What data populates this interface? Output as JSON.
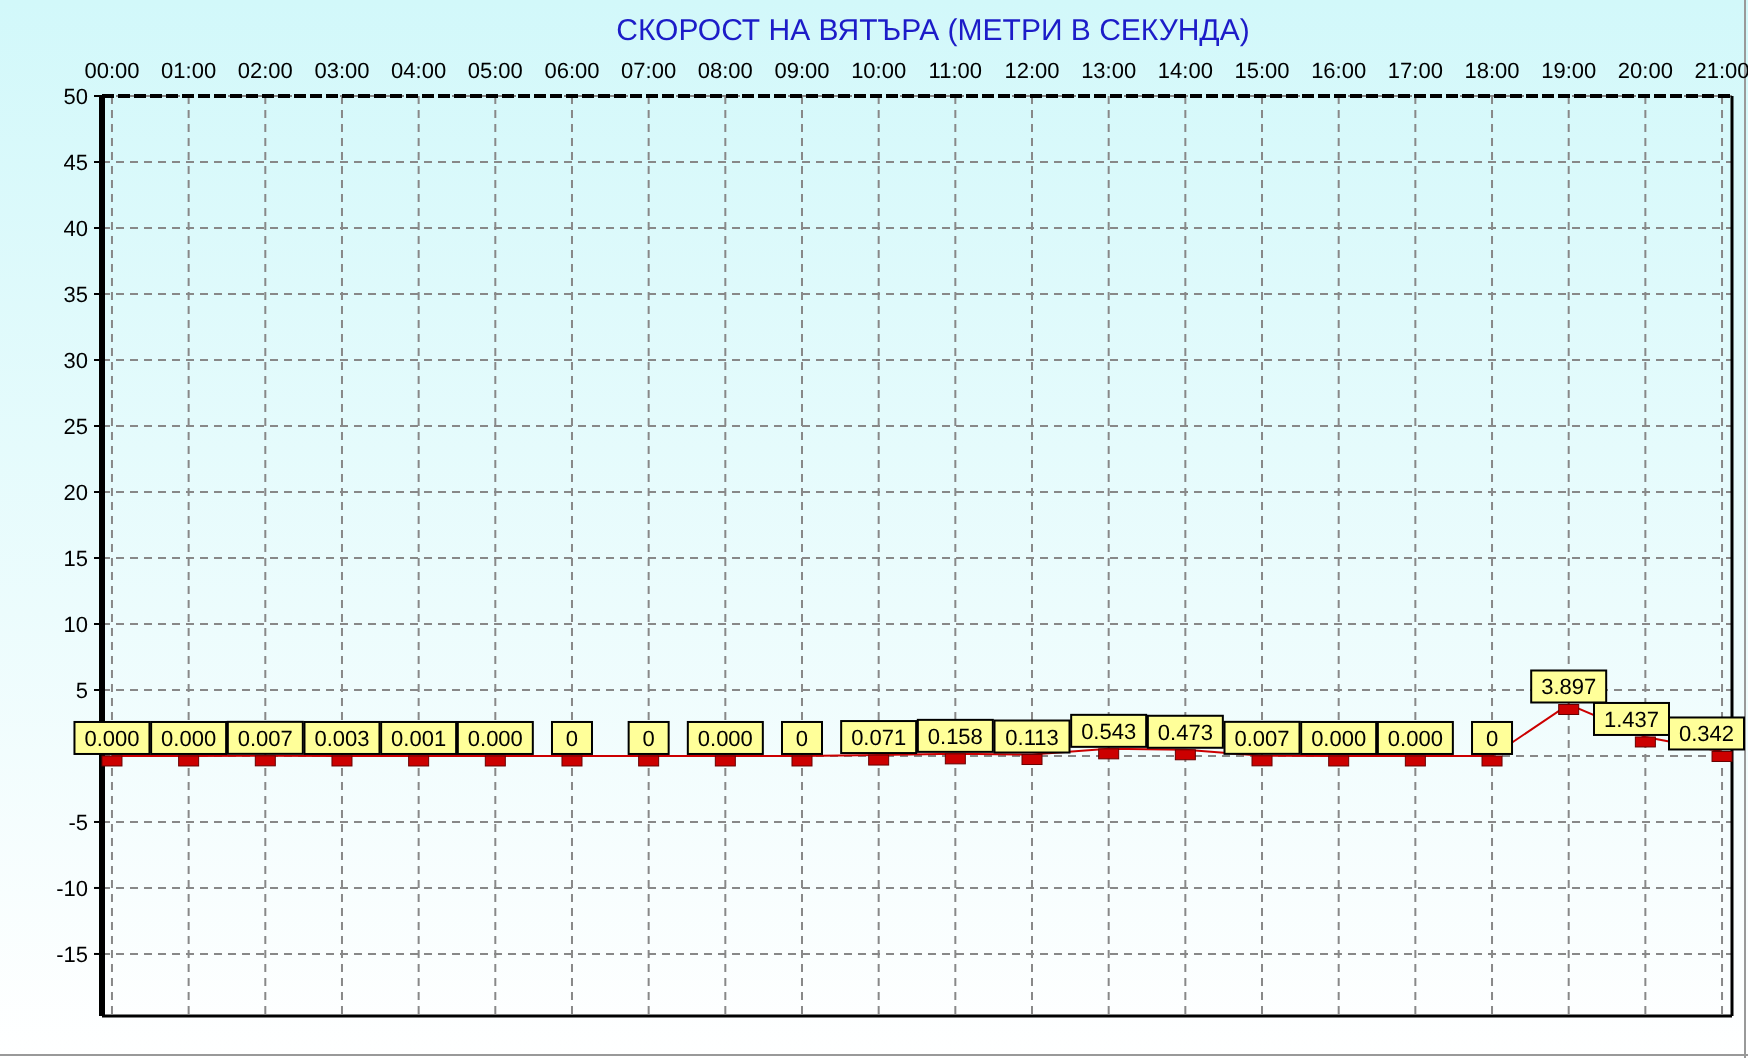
{
  "chart_data": {
    "type": "line",
    "title": "СКОРОСТ НА ВЯТЪРА (МЕТРИ В СЕКУНДА)",
    "categories": [
      "00:00",
      "01:00",
      "02:00",
      "03:00",
      "04:00",
      "05:00",
      "06:00",
      "07:00",
      "08:00",
      "09:00",
      "10:00",
      "11:00",
      "12:00",
      "13:00",
      "14:00",
      "15:00",
      "16:00",
      "17:00",
      "18:00",
      "19:00",
      "20:00",
      "21:00"
    ],
    "series": [
      {
        "color": "#cc0000",
        "values": [
          0,
          0,
          0.01,
          0,
          0,
          0,
          0,
          0,
          0,
          0,
          0.07,
          0.16,
          0.11,
          0.54,
          0.47,
          0.01,
          0,
          0,
          0,
          3.9,
          1.44,
          0.34
        ]
      }
    ],
    "grid": true,
    "value_labels": [
      "0.000",
      "0.000",
      "0.007",
      "0.003",
      "0.001",
      "0.000",
      "0",
      "0",
      "0.000",
      "0",
      "0.071",
      "0.158",
      "0.113",
      "0.543",
      "0.473",
      "0.007",
      "0.000",
      "0.000",
      "0",
      "3.897",
      "1.437",
      "0.342"
    ],
    "ylim": [
      -19.7,
      50
    ],
    "yticks": [
      -15,
      -10,
      -5,
      5,
      10,
      15,
      20,
      25,
      30,
      35,
      40,
      45,
      50
    ]
  }
}
